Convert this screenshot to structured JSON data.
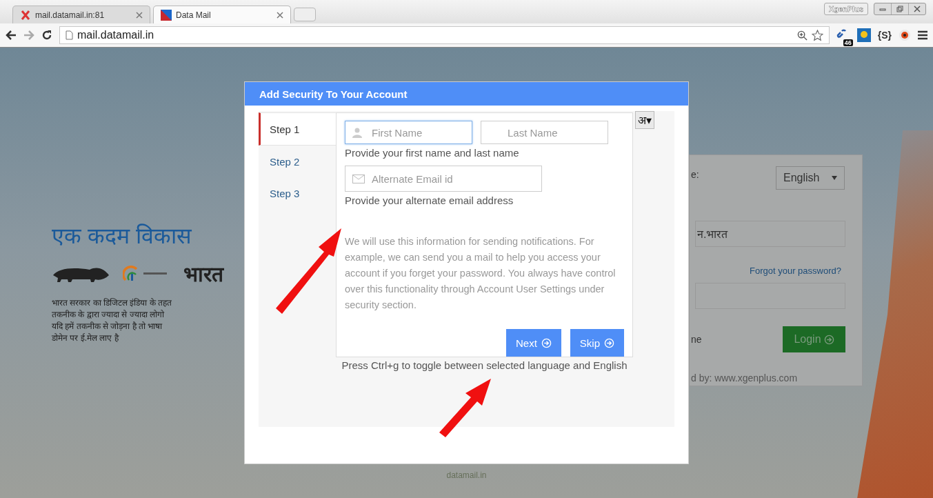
{
  "browser": {
    "tabs": [
      {
        "title": "mail.datamail.in:81",
        "selected": false
      },
      {
        "title": "Data Mail",
        "selected": true
      }
    ],
    "address": "mail.datamail.in",
    "profile": "XgenPlus",
    "extension_badge": "46",
    "extension_label": "{S}"
  },
  "background": {
    "heading": "एक कदम विकास",
    "brand": "भारत",
    "paragraph_lines": [
      "भारत सरकार का डिजिटल इंडिया के तहत",
      "तकनीक के द्वारा ज्यादा से ज्यादा लोगो",
      "यदि हमें तकनीक से जोड़ना है तो भाषा",
      "डोमेन पर ई.मेल लाए है"
    ],
    "login": {
      "language_label": "e:",
      "language": "English",
      "username": "न.भारत",
      "forgot": "Forgot your password?",
      "remember": "ne",
      "login_button": "Login",
      "powered": "d by: www.xgenplus.com"
    },
    "footer": "datamail.in"
  },
  "dialog": {
    "title": "Add Security To Your Account",
    "steps": [
      {
        "label": "Step 1",
        "selected": true
      },
      {
        "label": "Step 2",
        "selected": false
      },
      {
        "label": "Step 3",
        "selected": false
      }
    ],
    "first_name": {
      "placeholder": "First Name"
    },
    "last_name": {
      "placeholder": "Last Name"
    },
    "name_hint": "Provide your first name and last name",
    "email": {
      "placeholder": "Alternate Email id"
    },
    "email_hint": "Provide your alternate email address",
    "info": "We will use this information for sending notifications. For example, we can send you a mail to help you access your account if you forget your password. You always have control over this functionality through Account User Settings under security section.",
    "buttons": [
      {
        "label": "Next"
      },
      {
        "label": "Skip"
      }
    ],
    "language_toggle": "अ▾",
    "ctrl_hint": "Press Ctrl+g to toggle between selected language and English"
  }
}
